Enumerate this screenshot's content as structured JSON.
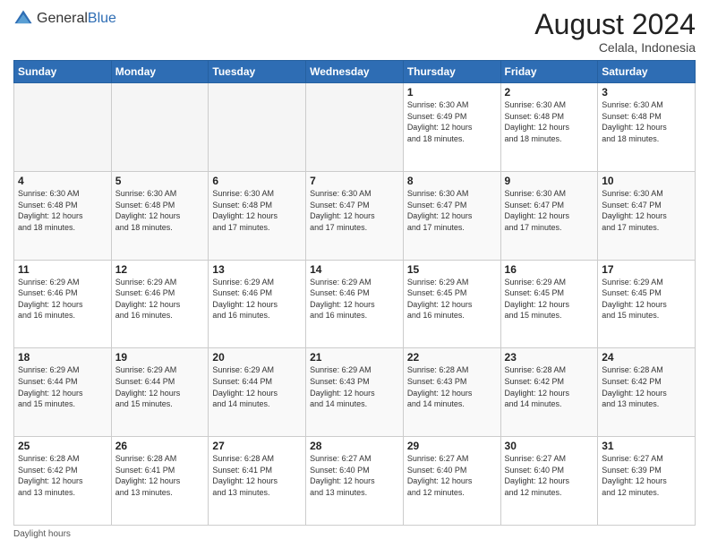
{
  "header": {
    "logo_general": "General",
    "logo_blue": "Blue",
    "month_year": "August 2024",
    "location": "Celala, Indonesia"
  },
  "footer": {
    "daylight_label": "Daylight hours"
  },
  "days_of_week": [
    "Sunday",
    "Monday",
    "Tuesday",
    "Wednesday",
    "Thursday",
    "Friday",
    "Saturday"
  ],
  "weeks": [
    [
      {
        "day": "",
        "info": ""
      },
      {
        "day": "",
        "info": ""
      },
      {
        "day": "",
        "info": ""
      },
      {
        "day": "",
        "info": ""
      },
      {
        "day": "1",
        "info": "Sunrise: 6:30 AM\nSunset: 6:49 PM\nDaylight: 12 hours\nand 18 minutes."
      },
      {
        "day": "2",
        "info": "Sunrise: 6:30 AM\nSunset: 6:48 PM\nDaylight: 12 hours\nand 18 minutes."
      },
      {
        "day": "3",
        "info": "Sunrise: 6:30 AM\nSunset: 6:48 PM\nDaylight: 12 hours\nand 18 minutes."
      }
    ],
    [
      {
        "day": "4",
        "info": "Sunrise: 6:30 AM\nSunset: 6:48 PM\nDaylight: 12 hours\nand 18 minutes."
      },
      {
        "day": "5",
        "info": "Sunrise: 6:30 AM\nSunset: 6:48 PM\nDaylight: 12 hours\nand 18 minutes."
      },
      {
        "day": "6",
        "info": "Sunrise: 6:30 AM\nSunset: 6:48 PM\nDaylight: 12 hours\nand 17 minutes."
      },
      {
        "day": "7",
        "info": "Sunrise: 6:30 AM\nSunset: 6:47 PM\nDaylight: 12 hours\nand 17 minutes."
      },
      {
        "day": "8",
        "info": "Sunrise: 6:30 AM\nSunset: 6:47 PM\nDaylight: 12 hours\nand 17 minutes."
      },
      {
        "day": "9",
        "info": "Sunrise: 6:30 AM\nSunset: 6:47 PM\nDaylight: 12 hours\nand 17 minutes."
      },
      {
        "day": "10",
        "info": "Sunrise: 6:30 AM\nSunset: 6:47 PM\nDaylight: 12 hours\nand 17 minutes."
      }
    ],
    [
      {
        "day": "11",
        "info": "Sunrise: 6:29 AM\nSunset: 6:46 PM\nDaylight: 12 hours\nand 16 minutes."
      },
      {
        "day": "12",
        "info": "Sunrise: 6:29 AM\nSunset: 6:46 PM\nDaylight: 12 hours\nand 16 minutes."
      },
      {
        "day": "13",
        "info": "Sunrise: 6:29 AM\nSunset: 6:46 PM\nDaylight: 12 hours\nand 16 minutes."
      },
      {
        "day": "14",
        "info": "Sunrise: 6:29 AM\nSunset: 6:46 PM\nDaylight: 12 hours\nand 16 minutes."
      },
      {
        "day": "15",
        "info": "Sunrise: 6:29 AM\nSunset: 6:45 PM\nDaylight: 12 hours\nand 16 minutes."
      },
      {
        "day": "16",
        "info": "Sunrise: 6:29 AM\nSunset: 6:45 PM\nDaylight: 12 hours\nand 15 minutes."
      },
      {
        "day": "17",
        "info": "Sunrise: 6:29 AM\nSunset: 6:45 PM\nDaylight: 12 hours\nand 15 minutes."
      }
    ],
    [
      {
        "day": "18",
        "info": "Sunrise: 6:29 AM\nSunset: 6:44 PM\nDaylight: 12 hours\nand 15 minutes."
      },
      {
        "day": "19",
        "info": "Sunrise: 6:29 AM\nSunset: 6:44 PM\nDaylight: 12 hours\nand 15 minutes."
      },
      {
        "day": "20",
        "info": "Sunrise: 6:29 AM\nSunset: 6:44 PM\nDaylight: 12 hours\nand 14 minutes."
      },
      {
        "day": "21",
        "info": "Sunrise: 6:29 AM\nSunset: 6:43 PM\nDaylight: 12 hours\nand 14 minutes."
      },
      {
        "day": "22",
        "info": "Sunrise: 6:28 AM\nSunset: 6:43 PM\nDaylight: 12 hours\nand 14 minutes."
      },
      {
        "day": "23",
        "info": "Sunrise: 6:28 AM\nSunset: 6:42 PM\nDaylight: 12 hours\nand 14 minutes."
      },
      {
        "day": "24",
        "info": "Sunrise: 6:28 AM\nSunset: 6:42 PM\nDaylight: 12 hours\nand 13 minutes."
      }
    ],
    [
      {
        "day": "25",
        "info": "Sunrise: 6:28 AM\nSunset: 6:42 PM\nDaylight: 12 hours\nand 13 minutes."
      },
      {
        "day": "26",
        "info": "Sunrise: 6:28 AM\nSunset: 6:41 PM\nDaylight: 12 hours\nand 13 minutes."
      },
      {
        "day": "27",
        "info": "Sunrise: 6:28 AM\nSunset: 6:41 PM\nDaylight: 12 hours\nand 13 minutes."
      },
      {
        "day": "28",
        "info": "Sunrise: 6:27 AM\nSunset: 6:40 PM\nDaylight: 12 hours\nand 13 minutes."
      },
      {
        "day": "29",
        "info": "Sunrise: 6:27 AM\nSunset: 6:40 PM\nDaylight: 12 hours\nand 12 minutes."
      },
      {
        "day": "30",
        "info": "Sunrise: 6:27 AM\nSunset: 6:40 PM\nDaylight: 12 hours\nand 12 minutes."
      },
      {
        "day": "31",
        "info": "Sunrise: 6:27 AM\nSunset: 6:39 PM\nDaylight: 12 hours\nand 12 minutes."
      }
    ]
  ]
}
